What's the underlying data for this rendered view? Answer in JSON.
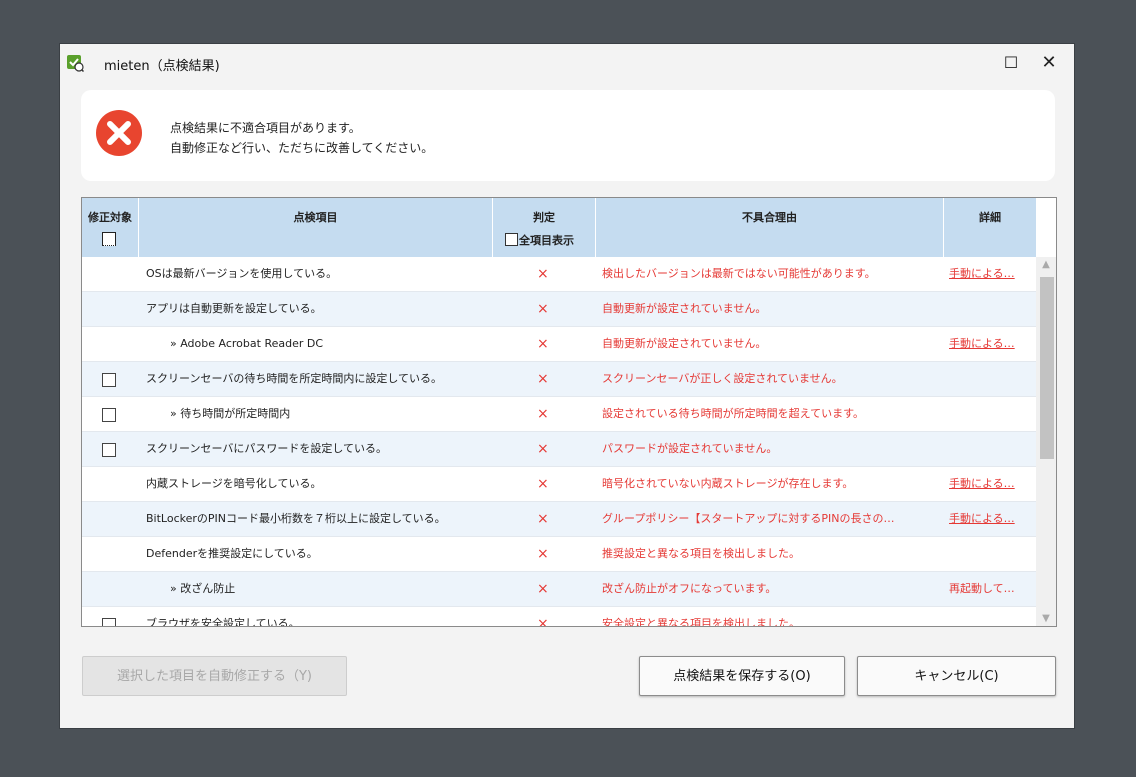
{
  "window": {
    "title": "mieten（点検結果)",
    "maximize_glyph": "☐",
    "close_glyph": "✕"
  },
  "alert": {
    "icon": "error-icon",
    "line1": "点検結果に不適合項目があります。",
    "line2": "自動修正など行い、ただちに改善してください。"
  },
  "table": {
    "headers": {
      "fix": "修正対象",
      "item": "点検項目",
      "verdict": "判定",
      "show_all": "全項目表示",
      "reason": "不具合理由",
      "detail": "詳細"
    },
    "rows": [
      {
        "item": "OSは最新バージョンを使用している。",
        "verdict": "×",
        "reason": "検出したバージョンは最新ではない可能性があります。",
        "detail": "手動による…"
      },
      {
        "item": "アプリは自動更新を設定している。",
        "verdict": "×",
        "reason": "自動更新が設定されていません。",
        "detail": ""
      },
      {
        "item": "» Adobe Acrobat Reader DC",
        "verdict": "×",
        "reason": "自動更新が設定されていません。",
        "detail": "手動による…"
      },
      {
        "item": "スクリーンセーバの待ち時間を所定時間内に設定している。",
        "verdict": "×",
        "reason": "スクリーンセーバが正しく設定されていません。",
        "detail": ""
      },
      {
        "item": "» 待ち時間が所定時間内",
        "verdict": "×",
        "reason": "設定されている待ち時間が所定時間を超えています。",
        "detail": ""
      },
      {
        "item": "スクリーンセーバにパスワードを設定している。",
        "verdict": "×",
        "reason": "パスワードが設定されていません。",
        "detail": ""
      },
      {
        "item": "内蔵ストレージを暗号化している。",
        "verdict": "×",
        "reason": "暗号化されていない内蔵ストレージが存在します。",
        "detail": "手動による…"
      },
      {
        "item": "BitLockerのPINコード最小桁数を７桁以上に設定している。",
        "verdict": "×",
        "reason": "グループポリシー【スタートアップに対するPINの長さの…",
        "detail": "手動による…"
      },
      {
        "item": "Defenderを推奨設定にしている。",
        "verdict": "×",
        "reason": "推奨設定と異なる項目を検出しました。",
        "detail": ""
      },
      {
        "item": "» 改ざん防止",
        "verdict": "×",
        "reason": "改ざん防止がオフになっています。",
        "detail": "再起動して…"
      },
      {
        "item": "ブラウザを安全設定している。",
        "verdict": "×",
        "reason": "安全設定と異なる項目を検出しました。",
        "detail": ""
      }
    ]
  },
  "buttons": {
    "autofix": "選択した項目を自動修正する（Y)",
    "save": "点検結果を保存する(O)",
    "cancel": "キャンセル(C)"
  },
  "colors": {
    "error_red": "#e53935",
    "header_blue": "#c5dcf0",
    "row_alt": "#edf4fb",
    "background": "#4b5157"
  }
}
